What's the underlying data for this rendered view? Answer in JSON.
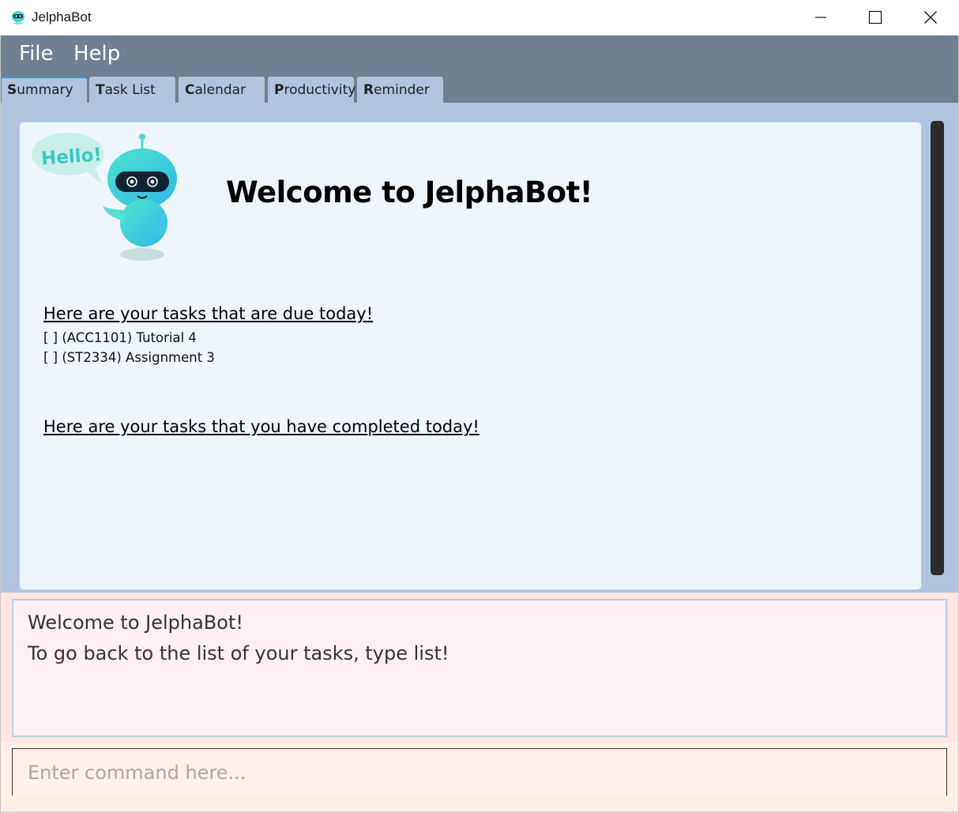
{
  "window": {
    "title": "JelphaBot",
    "controls": [
      "minimize-icon",
      "maximize-icon",
      "close-icon"
    ]
  },
  "menu": {
    "items": [
      {
        "label": "File"
      },
      {
        "label": "Help"
      }
    ]
  },
  "tabs": [
    {
      "mnemonic": "S",
      "rest": "ummary",
      "active": true
    },
    {
      "mnemonic": "T",
      "rest": "ask List",
      "active": false
    },
    {
      "mnemonic": "C",
      "rest": "alendar",
      "active": false
    },
    {
      "mnemonic": "P",
      "rest": "roductivity",
      "active": false
    },
    {
      "mnemonic": "R",
      "rest": "eminder",
      "active": false
    }
  ],
  "summary": {
    "bubble_text": "Hello!",
    "welcome_title": "Welcome to JelphaBot!",
    "due_today_heading": "Here are your tasks that are due today!",
    "due_today_tasks": [
      "[ ] (ACC1101) Tutorial 4",
      "[ ] (ST2334) Assignment 3"
    ],
    "completed_today_heading": "Here are your tasks that you have completed today!"
  },
  "result": {
    "lines": [
      "Welcome to JelphaBot!",
      "To go back to the list of your tasks, type list!"
    ]
  },
  "command": {
    "placeholder": "Enter command here...",
    "value": ""
  },
  "colors": {
    "menu_bar": "#708090",
    "tab_bg": "#b0c4de",
    "panel_bg": "#eef6fc",
    "result_bg": "#ffe4e1",
    "command_bg": "#ffefe6",
    "robot_body": "#37d6c9"
  }
}
